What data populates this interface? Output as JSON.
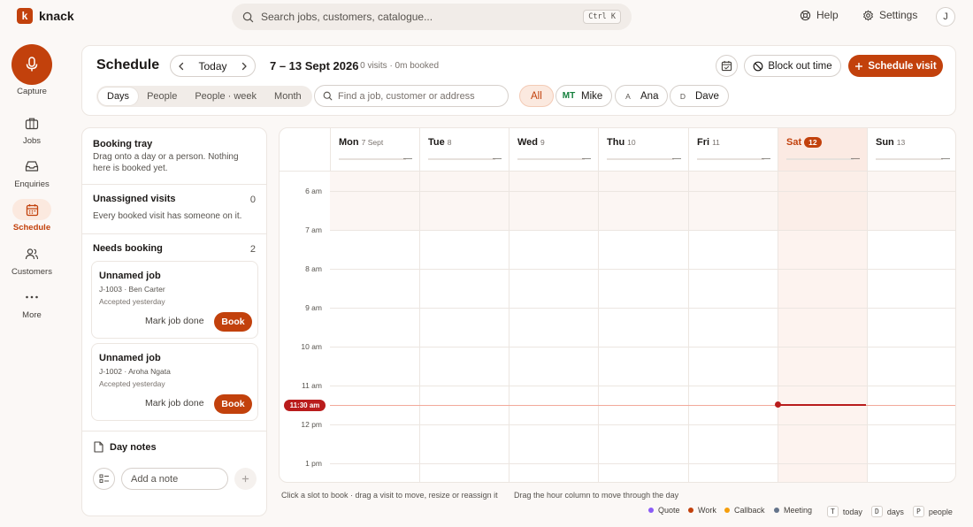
{
  "app": {
    "name": "knack",
    "logo_letter": "k",
    "brand_color": "#c2410c"
  },
  "topbar": {
    "search_placeholder": "Search jobs, customers, catalogue...",
    "search_shortcut": "Ctrl K",
    "help_label": "Help",
    "settings_label": "Settings",
    "user_initial": "J"
  },
  "nav": {
    "capture_label": "Capture",
    "items": [
      {
        "label": "Jobs",
        "icon": "briefcase-icon",
        "active": false
      },
      {
        "label": "Enquiries",
        "icon": "inbox-icon",
        "active": false
      },
      {
        "label": "Schedule",
        "icon": "calendar-icon",
        "active": true
      },
      {
        "label": "Customers",
        "icon": "users-icon",
        "active": false
      },
      {
        "label": "More",
        "icon": "more-icon",
        "active": false
      }
    ]
  },
  "header": {
    "title": "Schedule",
    "today_label": "Today",
    "range": "7 – 13 Sept 2026",
    "range_meta": "· 0 visits · 0m booked",
    "block_out_label": "Block out time",
    "schedule_visit_label": "Schedule visit",
    "views": [
      "Days",
      "People",
      "People · week",
      "Month"
    ],
    "active_view": "Days",
    "find_placeholder": "Find a job, customer or address",
    "filters": [
      {
        "badge": "",
        "label": "All"
      },
      {
        "badge": "MT",
        "label": "Mike"
      },
      {
        "badge": "A",
        "label": "Ana"
      },
      {
        "badge": "D",
        "label": "Dave"
      }
    ]
  },
  "tray": {
    "title": "Booking tray",
    "subtitle": "Drag onto a day or a person. Nothing here is booked yet.",
    "unassigned_title": "Unassigned visits",
    "unassigned_count": "0",
    "unassigned_sub": "Every booked visit has someone on it.",
    "needs_title": "Needs booking",
    "needs_count": "2",
    "jobs": [
      {
        "title": "Unnamed job",
        "ref": "J-1003 · Ben Carter",
        "when": "Accepted yesterday",
        "done_label": "Mark job done",
        "book_label": "Book"
      },
      {
        "title": "Unnamed job",
        "ref": "J-1002 · Aroha Ngata",
        "when": "Accepted yesterday",
        "done_label": "Mark job done",
        "book_label": "Book"
      }
    ],
    "day_notes_title": "Day notes",
    "note_placeholder": "Add a note"
  },
  "calendar": {
    "days": [
      {
        "name": "Mon",
        "num": "7 Sept",
        "today": false,
        "dash": "—"
      },
      {
        "name": "Tue",
        "num": "8",
        "today": false,
        "dash": "—"
      },
      {
        "name": "Wed",
        "num": "9",
        "today": false,
        "dash": "—"
      },
      {
        "name": "Thu",
        "num": "10",
        "today": false,
        "dash": "—"
      },
      {
        "name": "Fri",
        "num": "11",
        "today": false,
        "dash": "—"
      },
      {
        "name": "Sat",
        "num": "12",
        "today": true,
        "dash": "—"
      },
      {
        "name": "Sun",
        "num": "13",
        "today": false,
        "dash": "—"
      }
    ],
    "hours": [
      "6 am",
      "7 am",
      "8 am",
      "9 am",
      "10 am",
      "11 am",
      "12 pm",
      "1 pm"
    ],
    "now_label": "11:30 am"
  },
  "footer": {
    "hint_left": "Click a slot to book · drag a visit to move, resize or reassign it",
    "hint_right": "Drag the hour column to move through the day",
    "legend": [
      {
        "label": "Quote",
        "color": "#8b5cf6"
      },
      {
        "label": "Work",
        "color": "#c2410c"
      },
      {
        "label": "Callback",
        "color": "#f59e0b"
      },
      {
        "label": "Meeting",
        "color": "#64748b"
      }
    ],
    "shortcuts": [
      {
        "key": "T",
        "label": "today"
      },
      {
        "key": "D",
        "label": "days"
      },
      {
        "key": "P",
        "label": "people"
      }
    ]
  }
}
